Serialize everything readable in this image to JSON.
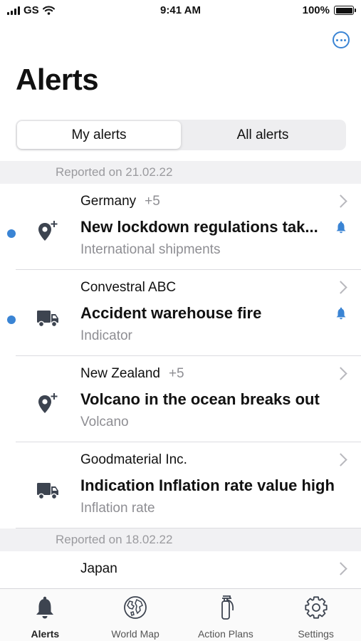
{
  "status_bar": {
    "carrier": "GS",
    "time": "9:41 AM",
    "battery": "100%"
  },
  "header": {
    "more_icon": "more-circle-icon",
    "title": "Alerts"
  },
  "segmented": {
    "options": [
      "My alerts",
      "All alerts"
    ],
    "selected": "My alerts"
  },
  "sections": [
    {
      "header": "Reported on 21.02.22",
      "rows": [
        {
          "location": "Germany",
          "extra": "+5",
          "title": "New lockdown regulations tak...",
          "subtitle": "International shipments",
          "icon": "location-plus-icon",
          "unread": true,
          "bell": true
        },
        {
          "location": "Convestral ABC",
          "extra": "",
          "title": "Accident warehouse fire",
          "subtitle": "Indicator",
          "icon": "truck-icon",
          "unread": true,
          "bell": true
        },
        {
          "location": "New Zealand",
          "extra": "+5",
          "title": "Volcano in the ocean breaks out",
          "subtitle": "Volcano",
          "icon": "location-plus-icon",
          "unread": false,
          "bell": false
        },
        {
          "location": "Goodmaterial Inc.",
          "extra": "",
          "title": "Indication Inflation rate value high",
          "subtitle": "Inflation rate",
          "icon": "truck-icon",
          "unread": false,
          "bell": false
        }
      ]
    },
    {
      "header": "Reported on 18.02.22",
      "rows": [
        {
          "location": "Japan",
          "extra": "",
          "title": "",
          "subtitle": "",
          "icon": "location-plus-icon",
          "unread": false,
          "bell": false
        }
      ]
    }
  ],
  "tab_bar": {
    "tabs": [
      {
        "label": "Alerts",
        "icon": "bell-icon",
        "active": true
      },
      {
        "label": "World Map",
        "icon": "globe-icon",
        "active": false
      },
      {
        "label": "Action Plans",
        "icon": "fire-extinguisher-icon",
        "active": false
      },
      {
        "label": "Settings",
        "icon": "gear-icon",
        "active": false
      }
    ]
  },
  "colors": {
    "accent": "#3a84d4",
    "icon": "#3d4450",
    "section_bg": "#f1f1f3"
  }
}
